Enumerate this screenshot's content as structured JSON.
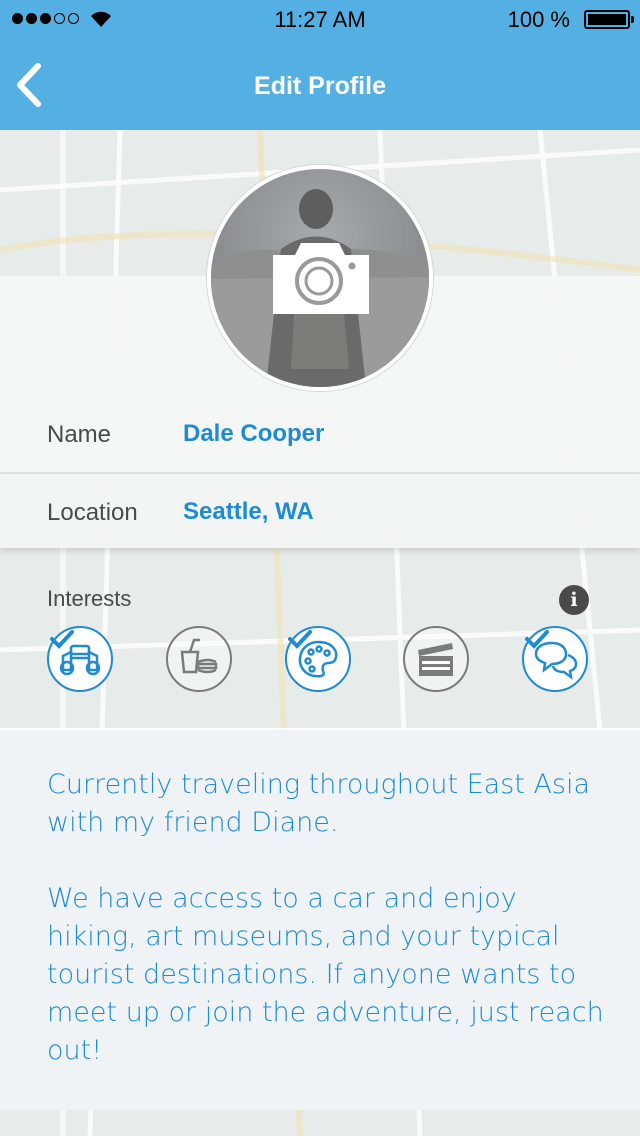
{
  "status_bar": {
    "time": "11:27 AM",
    "battery": "100 %",
    "signal_dots_filled": 3,
    "signal_dots_total": 5
  },
  "nav": {
    "title": "Edit Profile",
    "back_icon": "chevron-left-icon"
  },
  "profile": {
    "avatar_icon": "camera-icon",
    "name_label": "Name",
    "name_value": "Dale Cooper",
    "location_label": "Location",
    "location_value": "Seattle, WA"
  },
  "interests": {
    "title": "Interests",
    "info_icon": "info-icon",
    "info_glyph": "i",
    "items": [
      {
        "icon": "binoculars-icon",
        "selected": true
      },
      {
        "icon": "food-drink-icon",
        "selected": false
      },
      {
        "icon": "art-palette-icon",
        "selected": true
      },
      {
        "icon": "movie-clapper-icon",
        "selected": false
      },
      {
        "icon": "chat-bubbles-icon",
        "selected": true
      }
    ]
  },
  "bio": {
    "text": "Currently traveling throughout East Asia with my friend Diane.\n\nWe have access to a car and enjoy hiking, art museums, and your typical tourist destinations. If anyone wants to meet up or join the adventure, just reach out!"
  },
  "colors": {
    "accent": "#1f8bd0",
    "header": "#54b0e3",
    "label": "#4a4a4a"
  }
}
